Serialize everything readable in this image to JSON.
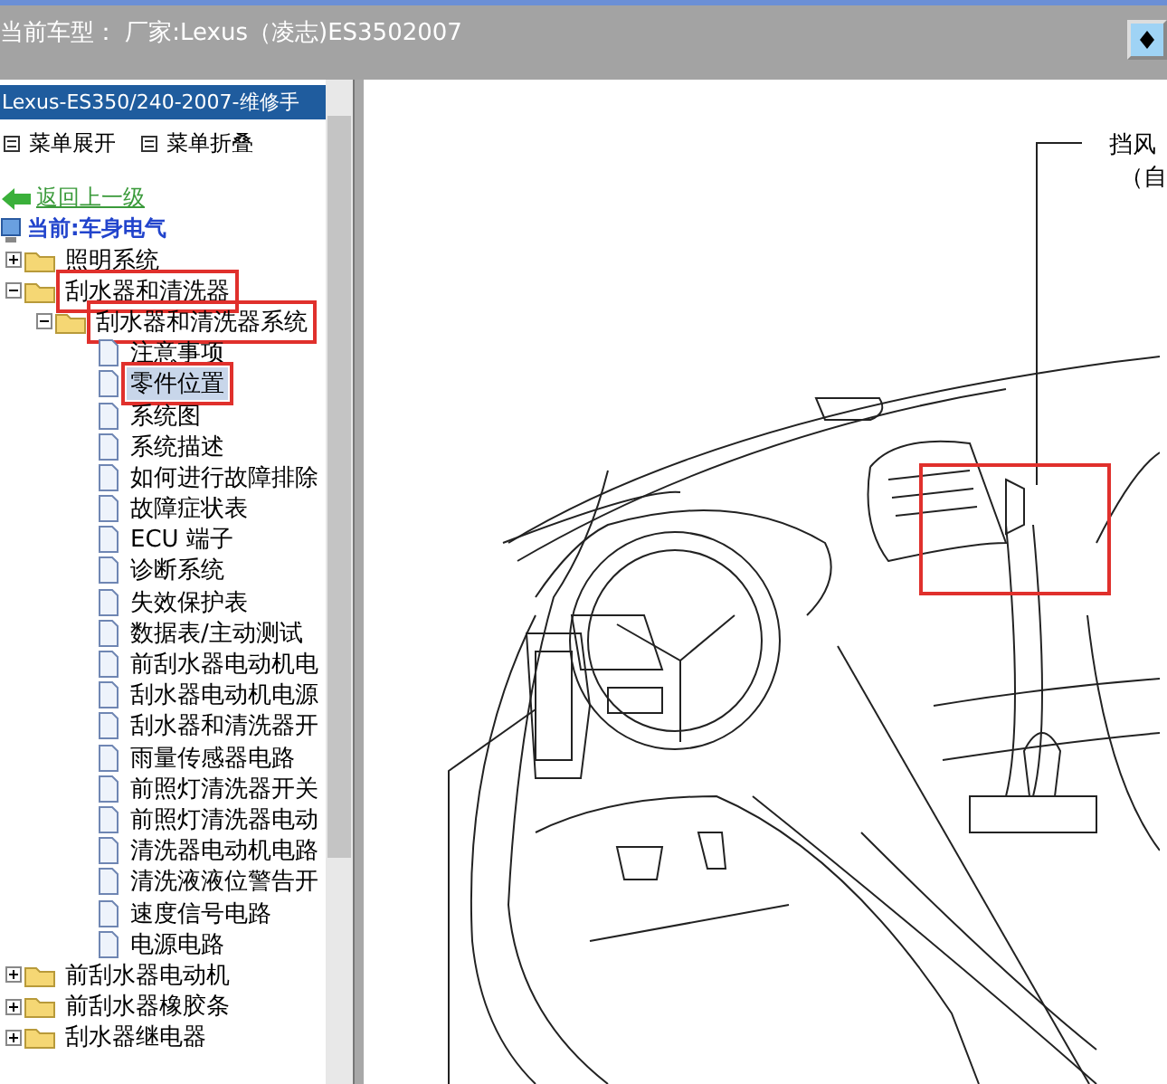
{
  "title_bar": {
    "title": "当前车型： 厂家:Lexus（凌志)ES3502007"
  },
  "sidebar": {
    "header": "Lexus-ES350/240-2007-维修手",
    "menu": [
      {
        "label": "菜单展开"
      },
      {
        "label": "菜单折叠"
      }
    ],
    "back_link": "返回上一级",
    "current": "当前:车身电气",
    "tree": [
      {
        "label": "照明系统",
        "expanded": false,
        "marked": false,
        "selected": false
      },
      {
        "label": "刮水器和清洗器",
        "expanded": true,
        "marked": true,
        "selected": false,
        "children": [
          {
            "label": "刮水器和清洗器系统",
            "expanded": true,
            "marked": true,
            "selected": false,
            "children": [
              {
                "label": "注意事项",
                "marked": false,
                "selected": false
              },
              {
                "label": "零件位置",
                "marked": true,
                "selected": true
              },
              {
                "label": "系统图",
                "marked": false,
                "selected": false
              },
              {
                "label": "系统描述",
                "marked": false,
                "selected": false
              },
              {
                "label": "如何进行故障排除",
                "marked": false,
                "selected": false
              },
              {
                "label": "故障症状表",
                "marked": false,
                "selected": false
              },
              {
                "label": "ECU 端子",
                "marked": false,
                "selected": false
              },
              {
                "label": "诊断系统",
                "marked": false,
                "selected": false
              },
              {
                "label": "失效保护表",
                "marked": false,
                "selected": false
              },
              {
                "label": "数据表/主动测试",
                "marked": false,
                "selected": false
              },
              {
                "label": "前刮水器电动机电",
                "marked": false,
                "selected": false
              },
              {
                "label": "刮水器电动机电源",
                "marked": false,
                "selected": false
              },
              {
                "label": "刮水器和清洗器开",
                "marked": false,
                "selected": false
              },
              {
                "label": "雨量传感器电路",
                "marked": false,
                "selected": false
              },
              {
                "label": "前照灯清洗器开关",
                "marked": false,
                "selected": false
              },
              {
                "label": "前照灯清洗器电动",
                "marked": false,
                "selected": false
              },
              {
                "label": "清洗器电动机电路",
                "marked": false,
                "selected": false
              },
              {
                "label": "清洗液液位警告开",
                "marked": false,
                "selected": false
              },
              {
                "label": "速度信号电路",
                "marked": false,
                "selected": false
              },
              {
                "label": "电源电路",
                "marked": false,
                "selected": false
              }
            ]
          }
        ]
      },
      {
        "label": "前刮水器电动机",
        "expanded": false,
        "marked": false,
        "selected": false
      },
      {
        "label": "前刮水器橡胶条",
        "expanded": false,
        "marked": false,
        "selected": false
      },
      {
        "label": "刮水器继电器",
        "expanded": false,
        "marked": false,
        "selected": false
      }
    ]
  },
  "diagram": {
    "callout": [
      "挡风",
      "（自"
    ],
    "marked": true
  }
}
